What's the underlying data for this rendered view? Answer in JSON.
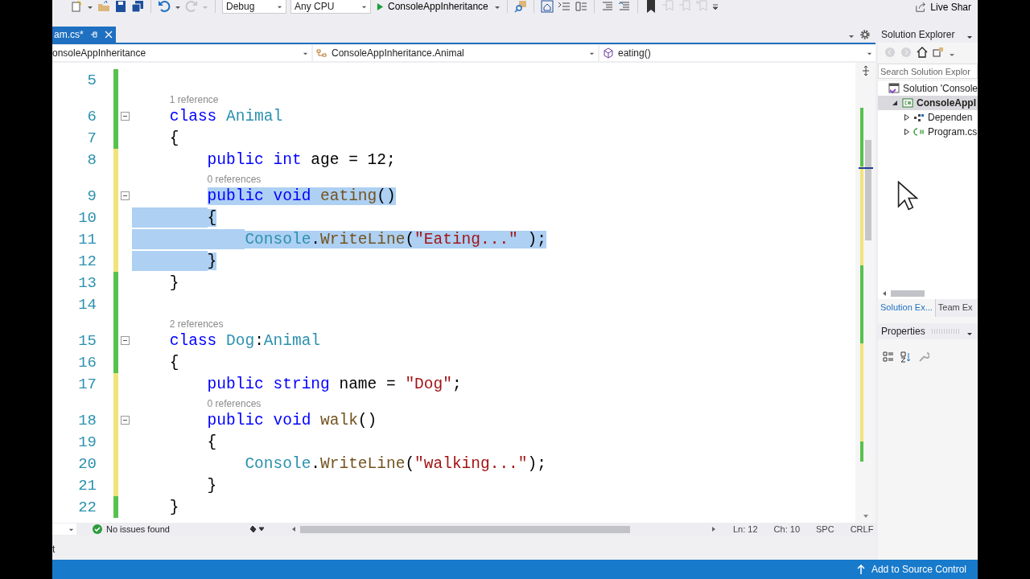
{
  "toolbar": {
    "configuration": "Debug",
    "platform": "Any CPU",
    "start_project": "ConsoleAppInheritance",
    "live_share": "Live Shar"
  },
  "document_tab": {
    "label": "am.cs*",
    "selected": true
  },
  "navigation": {
    "project": "onsoleAppInheritance",
    "type": "ConsoleAppInheritance.Animal",
    "member": "eating()"
  },
  "code_lines": [
    {
      "number": "5",
      "color": "#57c14f"
    },
    {
      "number": "6",
      "color": "#57c14f",
      "codelens": "1 reference",
      "fold": true,
      "tokens": [
        {
          "kind": "keyword",
          "text": "class",
          "selected": false
        },
        {
          "kind": "type",
          "text": " Animal",
          "selected": false
        }
      ]
    },
    {
      "number": "7",
      "color": "#57c14f",
      "tokens": [
        {
          "kind": "plain",
          "text": "{",
          "selected": false
        }
      ],
      "children": [
        {
          "number": "8",
          "color": "#f0e37a",
          "tokens": [
            {
              "kind": "keyword",
              "text": "public",
              "selected": false
            },
            {
              "kind": "keyword",
              "text": " int",
              "selected": false
            },
            {
              "kind": "plain",
              "text": " age = 12;",
              "selected": false
            }
          ]
        },
        {
          "number": "9",
          "color": "#f0e37a",
          "codelens": "0 references",
          "fold": true,
          "tokens": [
            {
              "kind": "keyword",
              "text": "public",
              "selected": true
            },
            {
              "kind": "keyword",
              "text": " void",
              "selected": true
            },
            {
              "kind": "method",
              "text": " eating",
              "selected": true
            },
            {
              "kind": "plain",
              "text": "()",
              "selected": true
            }
          ]
        },
        {
          "number": "10",
          "color": "#f0e37a",
          "indent_selected": true,
          "tokens": [
            {
              "kind": "plain",
              "text": "{",
              "selected": true
            }
          ],
          "children": [
            {
              "number": "11",
              "color": "#f0e37a",
              "indent_selected": true,
              "tokens": [
                {
                  "kind": "type",
                  "text": "Console",
                  "selected": true
                },
                {
                  "kind": "plain",
                  "text": ".",
                  "selected": true
                },
                {
                  "kind": "method",
                  "text": "WriteLine",
                  "selected": true
                },
                {
                  "kind": "plain",
                  "text": "(",
                  "selected": true
                },
                {
                  "kind": "string",
                  "text": "\"Eating...\"",
                  "selected": true
                },
                {
                  "kind": "plain",
                  "text": " );",
                  "selected": true
                }
              ]
            }
          ]
        },
        {
          "number": "12",
          "color": "#f0e37a",
          "indent_selected": true,
          "tokens": [
            {
              "kind": "plain",
              "text": "}",
              "selected": true
            }
          ]
        }
      ]
    },
    {
      "number": "13",
      "color": "#57c14f",
      "tokens": [
        {
          "kind": "plain",
          "text": "}",
          "selected": false
        }
      ]
    },
    {
      "number": "14",
      "color": "#57c14f"
    },
    {
      "number": "15",
      "color": "#57c14f",
      "codelens": "2 references",
      "fold": true,
      "tokens": [
        {
          "kind": "keyword",
          "text": "class",
          "selected": false
        },
        {
          "kind": "type",
          "text": " Dog",
          "selected": false
        },
        {
          "kind": "plain",
          "text": ":",
          "selected": false
        },
        {
          "kind": "type",
          "text": "Animal",
          "selected": false
        }
      ]
    },
    {
      "number": "16",
      "color": "#57c14f",
      "tokens": [
        {
          "kind": "plain",
          "text": "{",
          "selected": false
        }
      ],
      "children": [
        {
          "number": "17",
          "color": "#f0e37a",
          "tokens": [
            {
              "kind": "keyword",
              "text": "public",
              "selected": false
            },
            {
              "kind": "keyword",
              "text": " string",
              "selected": false
            },
            {
              "kind": "plain",
              "text": " name = ",
              "selected": false
            },
            {
              "kind": "string",
              "text": "\"Dog\"",
              "selected": false
            },
            {
              "kind": "plain",
              "text": ";",
              "selected": false
            }
          ]
        },
        {
          "number": "18",
          "color": "#f0e37a",
          "codelens": "0 references",
          "fold": true,
          "tokens": [
            {
              "kind": "keyword",
              "text": "public",
              "selected": false
            },
            {
              "kind": "keyword",
              "text": " void",
              "selected": false
            },
            {
              "kind": "method",
              "text": " walk",
              "selected": false
            },
            {
              "kind": "plain",
              "text": "()",
              "selected": false
            }
          ]
        },
        {
          "number": "19",
          "color": "#f0e37a",
          "tokens": [
            {
              "kind": "plain",
              "text": "{",
              "selected": false
            }
          ],
          "children": [
            {
              "number": "20",
              "color": "#f0e37a",
              "tokens": [
                {
                  "kind": "type",
                  "text": "Console",
                  "selected": false
                },
                {
                  "kind": "plain",
                  "text": ".",
                  "selected": false
                },
                {
                  "kind": "method",
                  "text": "WriteLine",
                  "selected": false
                },
                {
                  "kind": "plain",
                  "text": "(",
                  "selected": false
                },
                {
                  "kind": "string",
                  "text": "\"walking...\"",
                  "selected": false
                },
                {
                  "kind": "plain",
                  "text": ");",
                  "selected": false
                }
              ]
            }
          ]
        },
        {
          "number": "21",
          "color": "#f0e37a",
          "tokens": [
            {
              "kind": "plain",
              "text": "}",
              "selected": false
            }
          ]
        }
      ]
    },
    {
      "number": "22",
      "color": "#57c14f",
      "tokens": [
        {
          "kind": "plain",
          "text": "}",
          "selected": false
        }
      ]
    }
  ],
  "editor_status": {
    "issues": "No issues found",
    "line": "Ln: 12",
    "column": "Ch: 10",
    "whitespace": "SPC",
    "line_ending": "CRLF"
  },
  "output_fragment": "t",
  "solution_explorer": {
    "title": "Solution Explorer",
    "search": {
      "placeholder": "Search Solution Explor"
    },
    "tree": [
      {
        "kind": "solution",
        "label": "Solution 'Console",
        "selected": false,
        "children": [
          {
            "kind": "project",
            "label": "ConsoleAppI",
            "selected": true,
            "expanded": true,
            "children": [
              {
                "kind": "dependencies",
                "label": "Dependen",
                "selected": false,
                "expanded": false
              },
              {
                "kind": "file",
                "label": "Program.cs",
                "selected": false,
                "expanded": false
              }
            ]
          }
        ]
      }
    ],
    "tabs": [
      {
        "label": "Solution Ex...",
        "selected": true
      },
      {
        "label": "Team Ex",
        "selected": false
      }
    ]
  },
  "properties": {
    "title": "Properties"
  },
  "status_bar": {
    "source_control": "Add to Source Control"
  }
}
